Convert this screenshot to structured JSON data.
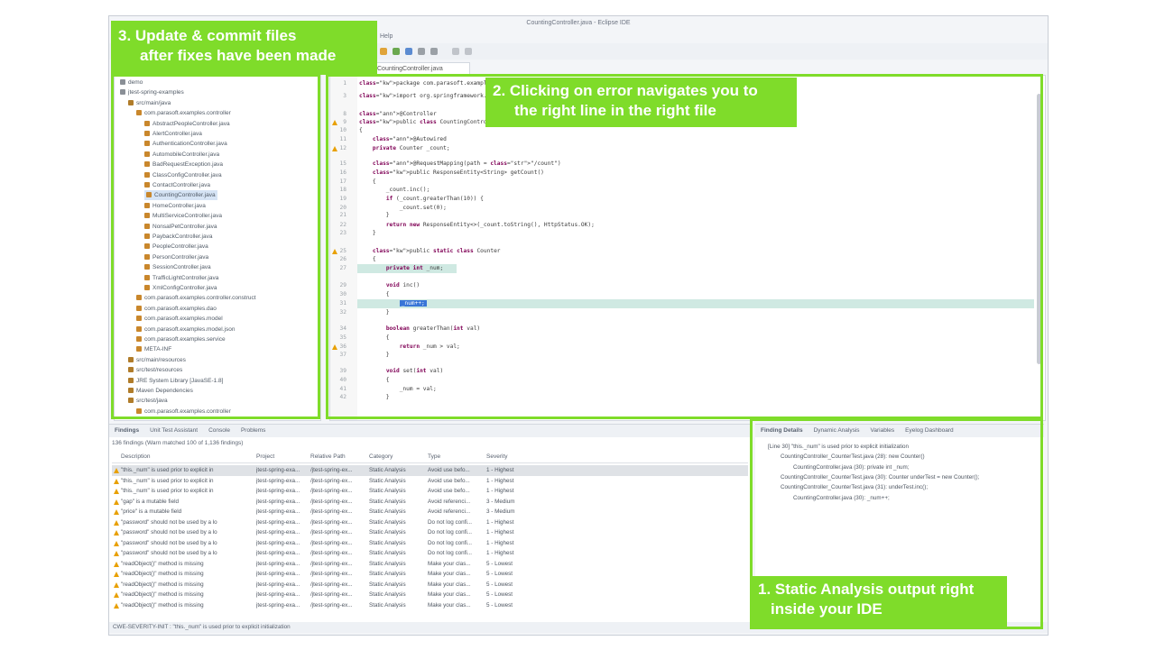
{
  "window": {
    "title": "CountingController.java - Eclipse IDE",
    "menu": "Help"
  },
  "editor": {
    "tab_label": "CountingController.java",
    "lines": [
      {
        "n": "1",
        "text": "package com.parasoft.examples.c"
      },
      {
        "n": "3",
        "text": "import org.springframework.bean"
      },
      {
        "n": "8",
        "text": "@Controller"
      },
      {
        "n": "9",
        "text": "public class CountingController"
      },
      {
        "n": "10",
        "text": "{"
      },
      {
        "n": "11",
        "text": "    @Autowired"
      },
      {
        "n": "12",
        "text": "    private Counter _count;"
      },
      {
        "n": "15",
        "text": "    @RequestMapping(path = \"/count\")"
      },
      {
        "n": "16",
        "text": "    public ResponseEntity<String> getCount()"
      },
      {
        "n": "17",
        "text": "    {"
      },
      {
        "n": "18",
        "text": "        _count.inc();"
      },
      {
        "n": "19",
        "text": "        if (_count.greaterThan(10)) {"
      },
      {
        "n": "20",
        "text": "            _count.set(0);"
      },
      {
        "n": "21",
        "text": "        }"
      },
      {
        "n": "22",
        "text": "        return new ResponseEntity<>(_count.toString(), HttpStatus.OK);"
      },
      {
        "n": "23",
        "text": "    }"
      },
      {
        "n": "25",
        "text": "    public static class Counter"
      },
      {
        "n": "26",
        "text": "    {"
      },
      {
        "n": "27",
        "text": "        private int _num;"
      },
      {
        "n": "29",
        "text": "        void inc()"
      },
      {
        "n": "30",
        "text": "        {"
      },
      {
        "n": "31",
        "text": "            _num++;"
      },
      {
        "n": "32",
        "text": "        }"
      },
      {
        "n": "34",
        "text": "        boolean greaterThan(int val)"
      },
      {
        "n": "35",
        "text": "        {"
      },
      {
        "n": "36",
        "text": "            return _num > val;"
      },
      {
        "n": "37",
        "text": "        }"
      },
      {
        "n": "39",
        "text": "        void set(int val)"
      },
      {
        "n": "40",
        "text": "        {"
      },
      {
        "n": "41",
        "text": "            _num = val;"
      },
      {
        "n": "42",
        "text": "        }"
      }
    ]
  },
  "tree": [
    {
      "text": "demo",
      "indent": 0
    },
    {
      "text": "jtest-spring-examples",
      "indent": 0
    },
    {
      "text": "src/main/java",
      "indent": 1
    },
    {
      "text": "com.parasoft.examples.controller",
      "indent": 2
    },
    {
      "text": "AbstractPeopleController.java",
      "indent": 3
    },
    {
      "text": "AlertController.java",
      "indent": 3
    },
    {
      "text": "AuthenticationController.java",
      "indent": 3
    },
    {
      "text": "AutomobileController.java",
      "indent": 3
    },
    {
      "text": "BadRequestException.java",
      "indent": 3
    },
    {
      "text": "ClassConfigController.java",
      "indent": 3
    },
    {
      "text": "ContactController.java",
      "indent": 3
    },
    {
      "text": "CountingController.java",
      "indent": 3,
      "selected": true
    },
    {
      "text": "HomeController.java",
      "indent": 3
    },
    {
      "text": "MultiServiceController.java",
      "indent": 3
    },
    {
      "text": "NonsalPetController.java",
      "indent": 3
    },
    {
      "text": "PaybackController.java",
      "indent": 3
    },
    {
      "text": "PeopleController.java",
      "indent": 3
    },
    {
      "text": "PersonController.java",
      "indent": 3
    },
    {
      "text": "SessionController.java",
      "indent": 3
    },
    {
      "text": "TrafficLightController.java",
      "indent": 3
    },
    {
      "text": "XmlConfigController.java",
      "indent": 3
    },
    {
      "text": "com.parasoft.examples.controller.construct",
      "indent": 2
    },
    {
      "text": "com.parasoft.examples.dao",
      "indent": 2
    },
    {
      "text": "com.parasoft.examples.model",
      "indent": 2
    },
    {
      "text": "com.parasoft.examples.model.json",
      "indent": 2
    },
    {
      "text": "com.parasoft.examples.service",
      "indent": 2
    },
    {
      "text": "META-INF",
      "indent": 2
    },
    {
      "text": "src/main/resources",
      "indent": 1
    },
    {
      "text": "src/test/resources",
      "indent": 1
    },
    {
      "text": "JRE System Library [JavaSE-1.8]",
      "indent": 1
    },
    {
      "text": "Maven Dependencies",
      "indent": 1
    },
    {
      "text": "src/test/java",
      "indent": 1
    },
    {
      "text": "com.parasoft.examples.controller",
      "indent": 2
    }
  ],
  "findings": {
    "tabs": [
      "Findings",
      "Unit Test Assistant",
      "Console",
      "Problems"
    ],
    "count": "136 findings (Warn matched 100 of 1,136 findings)",
    "columns": [
      "Description",
      "Project",
      "Relative Path",
      "Category",
      "Type",
      "Severity"
    ],
    "rows": [
      [
        "\"this._num\" is used prior to explicit in",
        "jtest-spring-exa...",
        "/jtest-spring-ex...",
        "Static Analysis",
        "Avoid use befo...",
        "1 - Highest"
      ],
      [
        "\"this._num\" is used prior to explicit in",
        "jtest-spring-exa...",
        "/jtest-spring-ex...",
        "Static Analysis",
        "Avoid use befo...",
        "1 - Highest"
      ],
      [
        "\"this._num\" is used prior to explicit in",
        "jtest-spring-exa...",
        "/jtest-spring-ex...",
        "Static Analysis",
        "Avoid use befo...",
        "1 - Highest"
      ],
      [
        "\"gap\" is a mutable field",
        "jtest-spring-exa...",
        "/jtest-spring-ex...",
        "Static Analysis",
        "Avoid referenci...",
        "3 - Medium"
      ],
      [
        "\"price\" is a mutable field",
        "jtest-spring-exa...",
        "/jtest-spring-ex...",
        "Static Analysis",
        "Avoid referenci...",
        "3 - Medium"
      ],
      [
        "\"password\" should not be used by a lo",
        "jtest-spring-exa...",
        "/jtest-spring-ex...",
        "Static Analysis",
        "Do not log confi...",
        "1 - Highest"
      ],
      [
        "\"password\" should not be used by a lo",
        "jtest-spring-exa...",
        "/jtest-spring-ex...",
        "Static Analysis",
        "Do not log confi...",
        "1 - Highest"
      ],
      [
        "\"password\" should not be used by a lo",
        "jtest-spring-exa...",
        "/jtest-spring-ex...",
        "Static Analysis",
        "Do not log confi...",
        "1 - Highest"
      ],
      [
        "\"password\" should not be used by a lo",
        "jtest-spring-exa...",
        "/jtest-spring-ex...",
        "Static Analysis",
        "Do not log confi...",
        "1 - Highest"
      ],
      [
        "\"readObject()\" method is missing",
        "jtest-spring-exa...",
        "/jtest-spring-ex...",
        "Static Analysis",
        "Make your clas...",
        "5 - Lowest"
      ],
      [
        "\"readObject()\" method is missing",
        "jtest-spring-exa...",
        "/jtest-spring-ex...",
        "Static Analysis",
        "Make your clas...",
        "5 - Lowest"
      ],
      [
        "\"readObject()\" method is missing",
        "jtest-spring-exa...",
        "/jtest-spring-ex...",
        "Static Analysis",
        "Make your clas...",
        "5 - Lowest"
      ],
      [
        "\"readObject()\" method is missing",
        "jtest-spring-exa...",
        "/jtest-spring-ex...",
        "Static Analysis",
        "Make your clas...",
        "5 - Lowest"
      ],
      [
        "\"readObject()\" method is missing",
        "jtest-spring-exa...",
        "/jtest-spring-ex...",
        "Static Analysis",
        "Make your clas...",
        "5 - Lowest"
      ]
    ]
  },
  "status_text": "CWE-SEVERITY-INIT : \"this._num\" is used prior to explicit initialization",
  "details": {
    "tabs": [
      "Finding Details",
      "Dynamic Analysis",
      "Variables",
      "Eyelog Dashboard"
    ],
    "rows": [
      {
        "text": "[Line 30] \"this._num\" is used prior to explicit initialization",
        "indent": 0
      },
      {
        "text": "CountingController_CounterTest.java (28): new Counter()",
        "indent": 1
      },
      {
        "text": "CountingController.java (30): private int _num;",
        "indent": 2
      },
      {
        "text": "CountingController_CounterTest.java (30): Counter underTest = new Counter();",
        "indent": 1
      },
      {
        "text": "CountingController_CounterTest.java (31): underTest.inc();",
        "indent": 1
      },
      {
        "text": "CountingController.java (30): _num++;",
        "indent": 2
      }
    ]
  },
  "callouts": {
    "update_line1": "3. Update & commit files",
    "update_line2": "after fixes have been made",
    "nav_line1": "2. Clicking on error navigates you to",
    "nav_line2": "the right line in the right file",
    "static_line1": "1. Static Analysis output right",
    "static_line2": "inside your IDE"
  },
  "colors": {
    "accent_green": "#7fdc2a",
    "warning": "#e8a000",
    "selection": "#3875d7"
  }
}
